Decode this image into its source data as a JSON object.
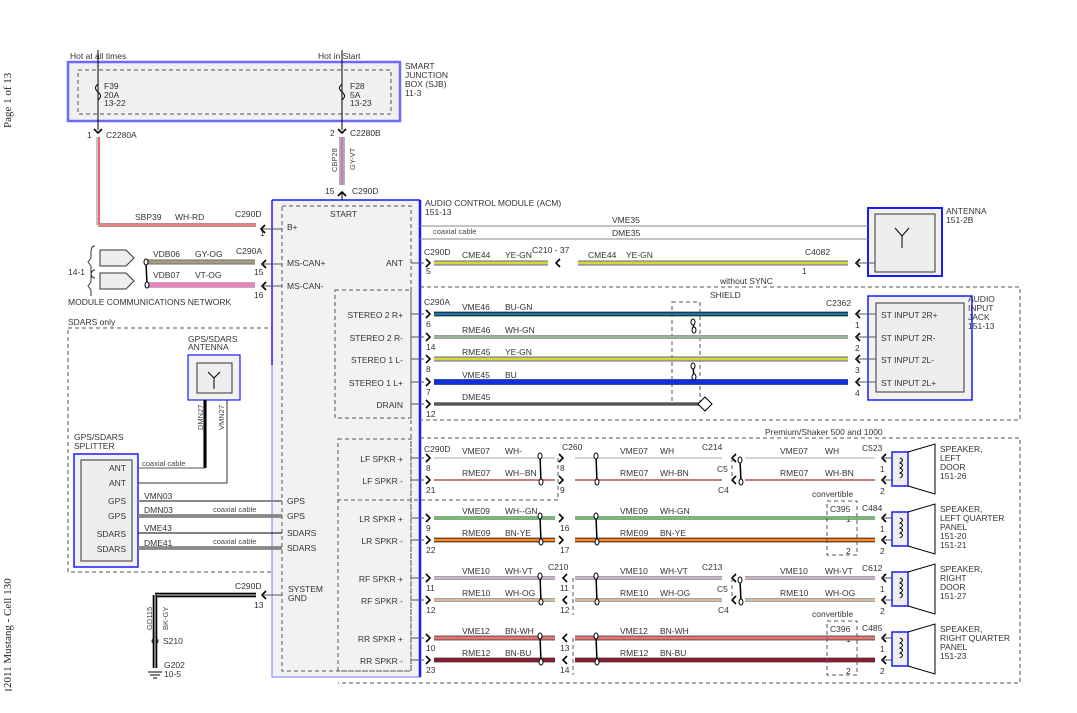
{
  "margin": {
    "page": "Page 1 of 13",
    "footer": "2011 Mustang - Cell 130"
  },
  "power": {
    "hot_always": "Hot at all times",
    "hot_start": "Hot in Start"
  },
  "sjb": {
    "name": [
      "SMART",
      "JUNCTION",
      "BOX (SJB)",
      "11-3"
    ],
    "fuse1": [
      "F39",
      "20A",
      "13-22"
    ],
    "fuse2": [
      "F28",
      "5A",
      "13-23"
    ]
  },
  "c2280a": {
    "pin": "1",
    "label": "C2280A"
  },
  "c2280b": {
    "pin": "2",
    "label": "C2280B"
  },
  "cbp28": {
    "circuit": "CBP28",
    "color": "GY-VT",
    "pin": "15",
    "conn": "C290D"
  },
  "sbp39": {
    "circuit": "SBP39",
    "color": "WH-RD",
    "conn": "C290D",
    "pin": "1"
  },
  "network": {
    "ref": "14-1",
    "label": "MODULE COMMUNICATIONS NETWORK",
    "conn": "C290A",
    "w1": {
      "circuit": "VDB06",
      "color": "GY-OG",
      "pin": "15"
    },
    "w2": {
      "circuit": "VDB07",
      "color": "VT-OG",
      "pin": "16"
    }
  },
  "acm": {
    "name": "AUDIO CONTROL MODULE (ACM)",
    "ref": "151-13",
    "pins": {
      "start": "START",
      "bplus": "B+",
      "mscanp": "MS-CAN+",
      "mscann": "MS-CAN-",
      "ant": "ANT",
      "gps1": "GPS",
      "gps2": "GPS",
      "sdars1": "SDARS",
      "sdars2": "SDARS",
      "gnd": [
        "SYSTEM",
        "GND"
      ]
    }
  },
  "antenna": {
    "name": "ANTENNA",
    "ref": "151-2B",
    "vme35": "VME35",
    "dme35": "DME35",
    "coax": "coaxial cable",
    "conn_acm": "C290D",
    "pin_acm": "5",
    "inline": "C210 - 37",
    "conn_ant": "C4082",
    "pin_ant": "1",
    "w": {
      "circuit": "CME44",
      "color": "YE-GN"
    }
  },
  "stereo": {
    "condition": "without SYNC",
    "shield": "SHIELD",
    "conn_acm": "C290A",
    "conn_jack": "C2362",
    "jack": {
      "name": [
        "AUDIO",
        "INPUT",
        "JACK",
        "151-13"
      ]
    },
    "rows": [
      {
        "acm_label": "STEREO 2 R+",
        "pin": "6",
        "circuit": "VME46",
        "color": "BU-GN",
        "jack_pin": "1",
        "jack_label": "ST INPUT 2R+"
      },
      {
        "acm_label": "STEREO 2 R-",
        "pin": "14",
        "circuit": "RME46",
        "color": "WH-GN",
        "jack_pin": "2",
        "jack_label": "ST INPUT 2R-"
      },
      {
        "acm_label": "STEREO 1 L-",
        "pin": "8",
        "circuit": "RME45",
        "color": "YE-GN",
        "jack_pin": "3",
        "jack_label": "ST INPUT 2L-"
      },
      {
        "acm_label": "STEREO 1 L+",
        "pin": "7",
        "circuit": "VME45",
        "color": "BU",
        "jack_pin": "4",
        "jack_label": "ST INPUT 2L+"
      },
      {
        "acm_label": "DRAIN",
        "pin": "12",
        "circuit": "DME45",
        "color": ""
      }
    ]
  },
  "speakers": {
    "condition": "Premium/Shaker 500 and 1000",
    "conn_acm": "C290D",
    "convertible": "convertible",
    "groups": [
      {
        "inline1": "C260",
        "inline2": "C214",
        "inline2b": [
          "C5",
          "C4"
        ],
        "spk_conn": "C523",
        "in1_pins": [
          "8",
          "9"
        ],
        "spk_name": [
          "SPEAKER,",
          "LEFT",
          "DOOR",
          "151-26"
        ],
        "plus": {
          "acm_label": "LF SPKR +",
          "pin": "8",
          "circuit": "VME07",
          "color1": "WH-",
          "color": "WH",
          "spk_pin": "1"
        },
        "minus": {
          "acm_label": "LF SPKR -",
          "pin": "21",
          "circuit": "RME07",
          "color1": "WH--BN",
          "color": "WH-BN",
          "spk_pin": "2"
        }
      },
      {
        "inline1_pins": [
          "16",
          "17"
        ],
        "conv_conn": "C395",
        "conv_pins": [
          "1",
          "2"
        ],
        "spk_conn": "C484",
        "spk_name": [
          "SPEAKER,",
          "LEFT QUARTER",
          "PANEL",
          "151-20",
          "151-21"
        ],
        "plus": {
          "acm_label": "LR SPKR +",
          "pin": "9",
          "circuit": "VME09",
          "color1": "WH--GN",
          "color": "WH-GN",
          "spk_pin": "1"
        },
        "minus": {
          "acm_label": "LR SPKR -",
          "pin": "22",
          "circuit": "RME09",
          "color1": "BN-YE",
          "color": "BN-YE",
          "spk_pin": "2"
        }
      },
      {
        "inline1": "C210",
        "in1_pins": [
          "11",
          "12"
        ],
        "inline2": "C213",
        "inline2b": [
          "C5",
          "C4"
        ],
        "spk_conn": "C612",
        "spk_name": [
          "SPEAKER,",
          "RIGHT",
          "DOOR",
          "151-27"
        ],
        "plus": {
          "acm_label": "RF SPKR +",
          "pin": "11",
          "circuit": "VME10",
          "color": "WH-VT",
          "spk_pin": "1"
        },
        "minus": {
          "acm_label": "RF SPKR -",
          "pin": "12",
          "circuit": "RME10",
          "color": "WH-OG",
          "spk_pin": "2"
        }
      },
      {
        "in1_pins": [
          "13",
          "14"
        ],
        "conv_conn": "C396",
        "conv_pins": [
          "1",
          "2"
        ],
        "spk_conn": "C485",
        "spk_name": [
          "SPEAKER,",
          "RIGHT QUARTER",
          "PANEL",
          "151-23"
        ],
        "plus": {
          "acm_label": "RR SPKR +",
          "pin": "10",
          "circuit": "VME12",
          "color": "BN-WH",
          "spk_pin": "1"
        },
        "minus": {
          "acm_label": "RR SPKR -",
          "pin": "23",
          "circuit": "RME12",
          "color": "BN-BU",
          "spk_pin": "2"
        }
      }
    ]
  },
  "sdars": {
    "condition": "SDARS only",
    "antenna": [
      "GPS/SDARS",
      "ANTENNA"
    ],
    "splitter": [
      "GPS/SDARS",
      "SPLITTER"
    ],
    "ant_wires": [
      "DMN27",
      "VMN27"
    ],
    "coax": "coaxial cable",
    "splitter_pins": [
      "ANT",
      "ANT",
      "GPS",
      "GPS",
      "SDARS",
      "SDARS"
    ],
    "circuits": [
      "VMN03",
      "DMN03",
      "VME43",
      "DME41"
    ]
  },
  "ground": {
    "conn": "C290D",
    "pin": "13",
    "circuit": "GD115",
    "color": "BK-GY",
    "splice": "S210",
    "gnd": "G202",
    "ref": "10-5"
  },
  "colors": {
    "module_border": "#1a1aff",
    "module_fill": "#f2f2f2",
    "wire_red": "#f03030",
    "wire_blue": "#1030e0",
    "wire_yellow": "#f0f000",
    "wire_green": "#70c070"
  }
}
